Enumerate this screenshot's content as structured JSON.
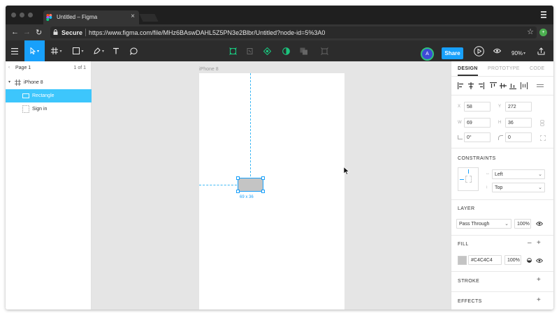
{
  "browser": {
    "tab_title": "Untitled – Figma",
    "tab_close": "×",
    "secure_label": "Secure",
    "url": "https://www.figma.com/file/MHz6BAswDAHL5Z5PN3e2Blbr/Untitled?node-id=5%3A0",
    "ext_label": "+"
  },
  "toolbar": {
    "share_label": "Share",
    "avatar_initial": "A",
    "zoom_label": "90%"
  },
  "layers_panel": {
    "page_name": "Page 1",
    "page_count": "1 of 1",
    "items": [
      {
        "label": "iPhone 8"
      },
      {
        "label": "Rectangle"
      },
      {
        "label": "Sign in"
      }
    ]
  },
  "canvas": {
    "frame_label": "iPhone 8",
    "dimension_label": "69 x 36"
  },
  "design_panel": {
    "tabs": [
      {
        "label": "DESIGN"
      },
      {
        "label": "PROTOTYPE"
      },
      {
        "label": "CODE"
      }
    ],
    "props": {
      "x_label": "X",
      "x_value": "58",
      "y_label": "Y",
      "y_value": "272",
      "w_label": "W",
      "w_value": "69",
      "h_label": "H",
      "h_value": "36",
      "rotation_value": "0°",
      "radius_value": "0"
    },
    "constraints": {
      "title": "CONSTRAINTS",
      "horizontal": "Left",
      "vertical": "Top"
    },
    "layer": {
      "title": "LAYER",
      "blend_mode": "Pass Through",
      "opacity": "100%"
    },
    "fill": {
      "title": "FILL",
      "hex": "#C4C4C4",
      "opacity": "100%",
      "color": "#c4c4c4"
    },
    "stroke": {
      "title": "STROKE"
    },
    "effects": {
      "title": "EFFECTS"
    }
  },
  "colors": {
    "accent": "#18a0fb",
    "selection": "#3dc6fc",
    "toolbar_bg": "#2c2c2c",
    "share_bg": "#18a0fb",
    "avatar_bg": "#3d4bd6",
    "avatar_ring": "#2ec37c"
  }
}
